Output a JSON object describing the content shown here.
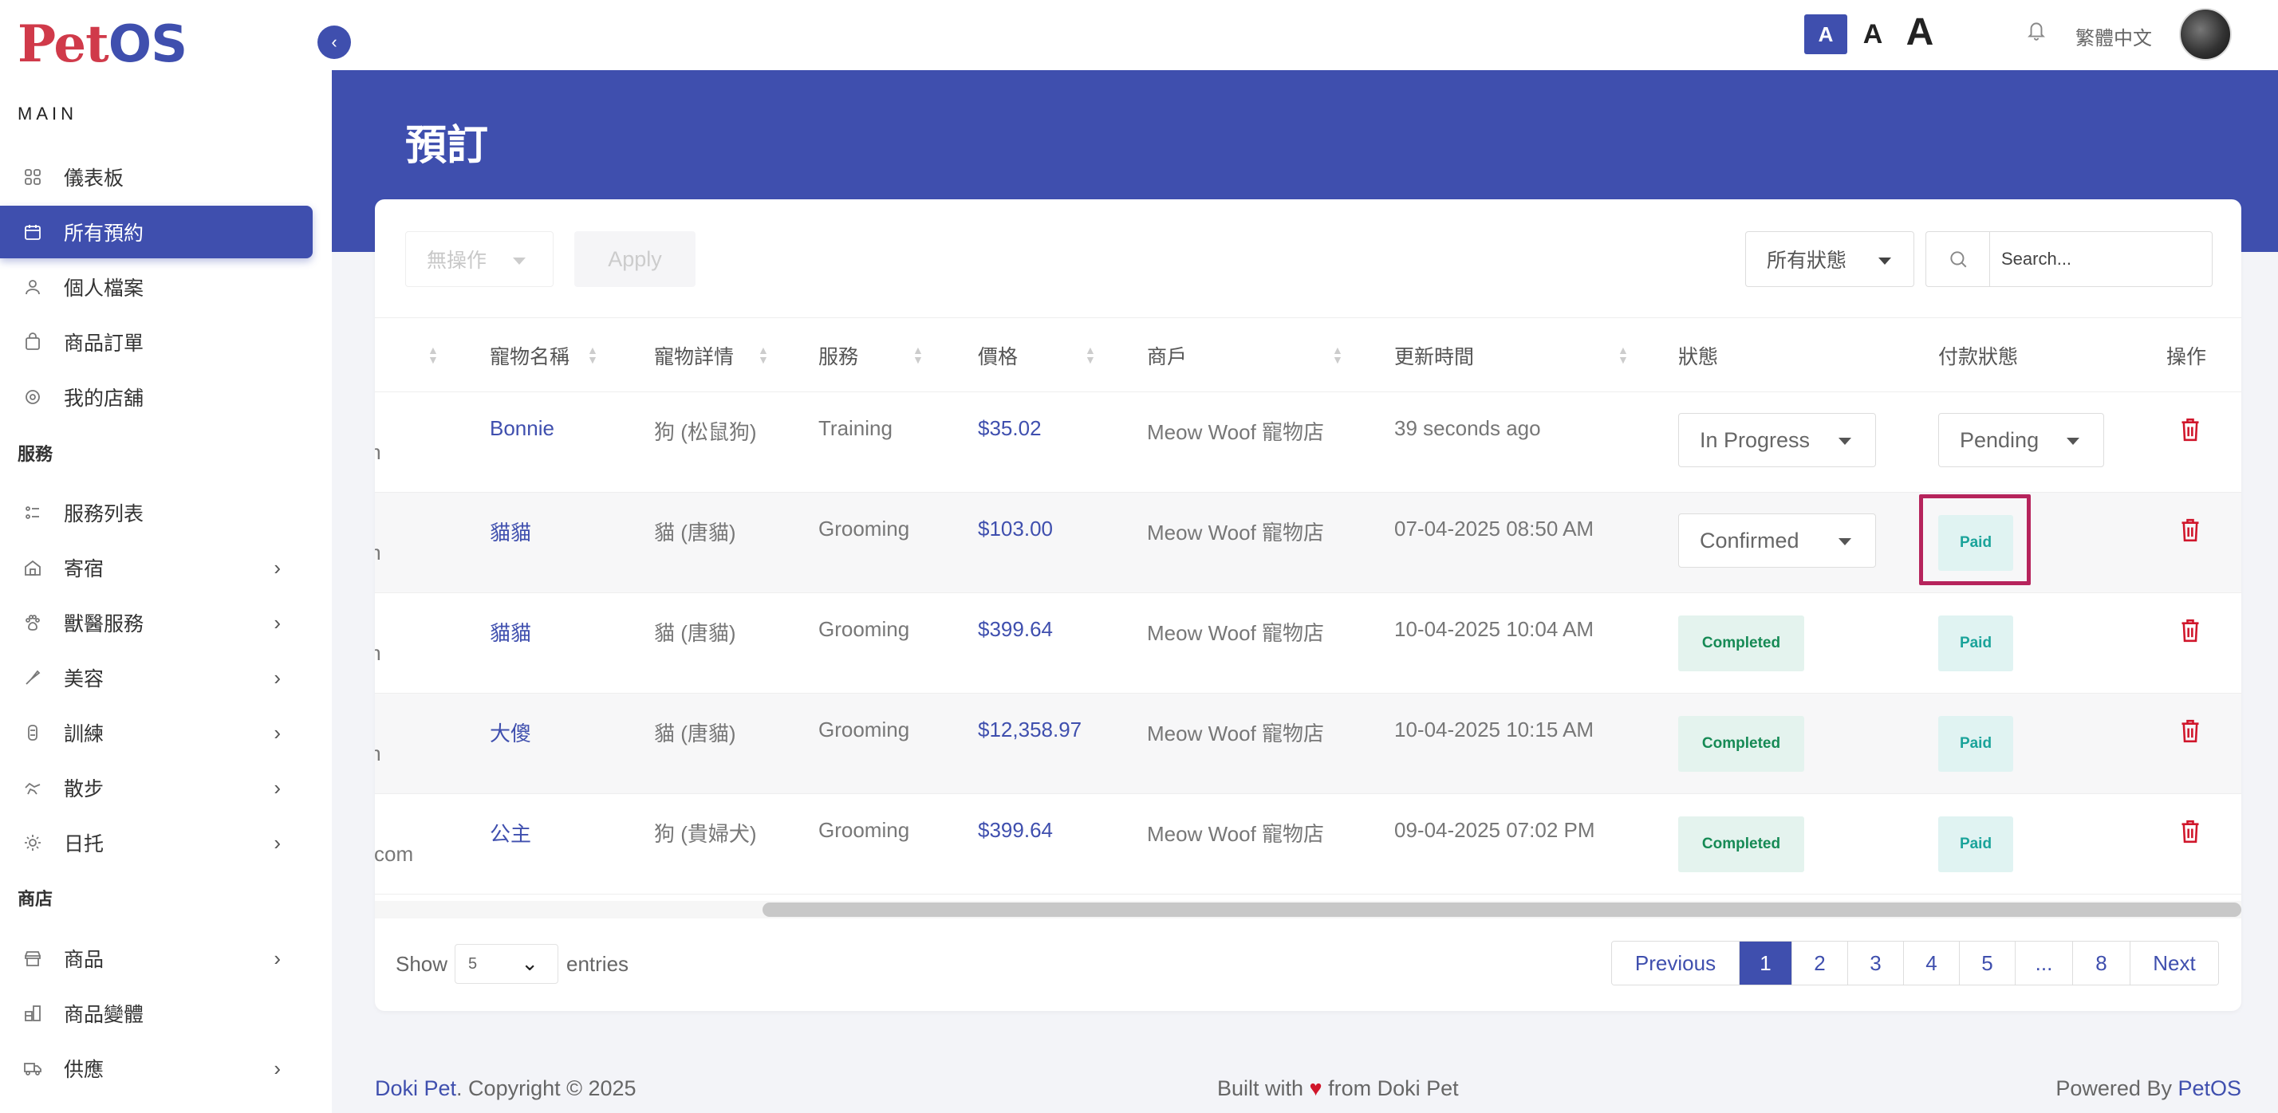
{
  "app": {
    "logo_pet": "Pet",
    "logo_os": "OS"
  },
  "sidebar": {
    "main_label": "MAIN",
    "services_label": "服務",
    "shop_label": "商店",
    "items": [
      {
        "label": "儀表板",
        "icon": "grid-icon"
      },
      {
        "label": "所有預約",
        "icon": "calendar-icon",
        "active": true
      },
      {
        "label": "個人檔案",
        "icon": "user-icon"
      },
      {
        "label": "商品訂單",
        "icon": "bag-icon"
      },
      {
        "label": "我的店舖",
        "icon": "gear-icon"
      },
      {
        "label": "服務列表",
        "icon": "list-icon"
      },
      {
        "label": "寄宿",
        "icon": "home-icon"
      },
      {
        "label": "獸醫服務",
        "icon": "paw-icon"
      },
      {
        "label": "美容",
        "icon": "brush-icon"
      },
      {
        "label": "訓練",
        "icon": "bone-icon"
      },
      {
        "label": "散步",
        "icon": "dog-walk-icon"
      },
      {
        "label": "日托",
        "icon": "sun-icon"
      },
      {
        "label": "商品",
        "icon": "store-icon"
      },
      {
        "label": "商品變體",
        "icon": "variant-icon"
      },
      {
        "label": "供應",
        "icon": "truck-icon"
      }
    ]
  },
  "topbar": {
    "font_small": "A",
    "font_medium": "A",
    "font_large": "A",
    "language": "繁體中文"
  },
  "page": {
    "title": "預訂"
  },
  "toolbar": {
    "bulk_action": "無操作",
    "apply_label": "Apply",
    "status_filter": "所有狀態",
    "search_placeholder": "Search..."
  },
  "table": {
    "headers": {
      "pet_name": "寵物名稱",
      "pet_detail": "寵物詳情",
      "service": "服務",
      "price": "價格",
      "merchant": "商戶",
      "updated": "更新時間",
      "status": "狀態",
      "payment_status": "付款狀態",
      "actions": "操作"
    },
    "rows": [
      {
        "email": "m",
        "pet_name": "Bonnie",
        "pet_detail": "狗 (松鼠狗)",
        "service": "Training",
        "price": "$35.02",
        "merchant": "Meow Woof 寵物店",
        "updated": "39 seconds ago",
        "status": "In Progress",
        "payment": "Pending"
      },
      {
        "email": "m",
        "pet_name": "貓貓",
        "pet_detail": "貓 (唐貓)",
        "service": "Grooming",
        "price": "$103.00",
        "merchant": "Meow Woof 寵物店",
        "updated": "07-04-2025 08:50 AM",
        "status": "Confirmed",
        "payment": "Paid"
      },
      {
        "email": "m",
        "pet_name": "貓貓",
        "pet_detail": "貓 (唐貓)",
        "service": "Grooming",
        "price": "$399.64",
        "merchant": "Meow Woof 寵物店",
        "updated": "10-04-2025 10:04 AM",
        "status": "Completed",
        "payment": "Paid"
      },
      {
        "email": "m",
        "pet_name": "大傻",
        "pet_detail": "貓 (唐貓)",
        "service": "Grooming",
        "price": "$12,358.97",
        "merchant": "Meow Woof 寵物店",
        "updated": "10-04-2025 10:15 AM",
        "status": "Completed",
        "payment": "Paid"
      },
      {
        "email": "l.com",
        "pet_name": "公主",
        "pet_detail": "狗 (貴婦犬)",
        "service": "Grooming",
        "price": "$399.64",
        "merchant": "Meow Woof 寵物店",
        "updated": "09-04-2025 07:02 PM",
        "status": "Completed",
        "payment": "Paid"
      }
    ]
  },
  "pagination": {
    "show_label": "Show",
    "entries_value": "5",
    "entries_label": "entries",
    "previous": "Previous",
    "pages": [
      "1",
      "2",
      "3",
      "4",
      "5",
      "...",
      "8"
    ],
    "next": "Next"
  },
  "footer": {
    "brand": "Doki Pet",
    "copyright": ". Copyright © 2025",
    "built_prefix": "Built with ",
    "heart": "♥",
    "built_suffix": " from Doki Pet",
    "powered_prefix": "Powered By ",
    "powered_brand": "PetOS"
  },
  "colors": {
    "primary": "#3f4fae",
    "danger": "#d0162b",
    "highlight_border": "#b6245c"
  }
}
